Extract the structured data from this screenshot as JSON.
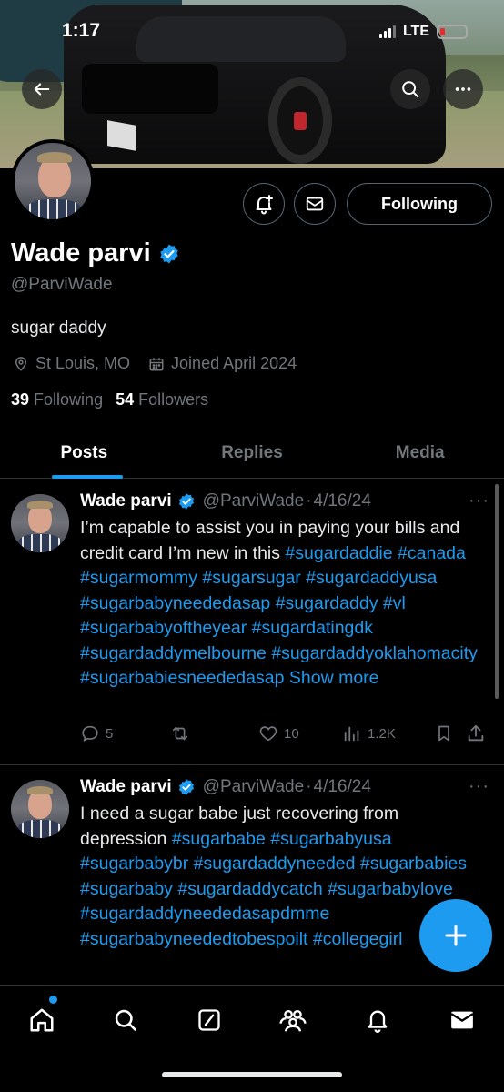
{
  "status_bar": {
    "time": "1:17",
    "network": "LTE"
  },
  "profile": {
    "name": "Wade parvi",
    "handle": "@ParviWade",
    "bio": "sugar daddy",
    "location": "St Louis, MO",
    "joined": "Joined April 2024",
    "following_count": "39",
    "following_label": "Following",
    "followers_count": "54",
    "followers_label": "Followers",
    "follow_button": "Following"
  },
  "tabs": [
    {
      "label": "Posts",
      "active": true
    },
    {
      "label": "Replies",
      "active": false
    },
    {
      "label": "Media",
      "active": false
    }
  ],
  "posts": [
    {
      "name": "Wade parvi",
      "handle": "@ParviWade",
      "sep": "·",
      "date": "4/16/24",
      "text": "I’m capable to assist you in paying your bills and credit card I’m new in this",
      "hashtags": [
        "#sugardaddie",
        "#canada",
        "#sugarmommy",
        "#sugarsugar",
        "#sugardaddyusa",
        "#sugarbabyneededasap",
        "#sugardaddy",
        "#vl",
        "#sugarbabyoftheyear",
        "#sugardatingdk",
        "#sugardaddymelbourne",
        "#sugardaddyoklahomacity",
        "#sugarbabiesneededasap"
      ],
      "show_more": "Show more",
      "replies": "5",
      "reposts": "",
      "likes": "10",
      "views": "1.2K"
    },
    {
      "name": "Wade parvi",
      "handle": "@ParviWade",
      "sep": "·",
      "date": "4/16/24",
      "text": "I need a sugar babe just recovering from depression",
      "hashtags": [
        "#sugarbabe",
        "#sugarbabyusa",
        "#sugarbabybr",
        "#sugardaddyneeded",
        "#sugarbabies",
        "#sugarbaby",
        "#sugardaddycatch",
        "#sugarbabylove",
        "#sugardaddyneededasapdmme",
        "#sugarbabyneededtobespoilt",
        "#collegegirl"
      ]
    }
  ],
  "colors": {
    "accent": "#1d9bf0",
    "background": "#000000",
    "muted": "#71767b",
    "battery_low": "#e0302f"
  },
  "icons": {
    "back": "arrow-left-icon",
    "search": "search-icon",
    "more": "more-horizontal-icon",
    "notify": "bell-plus-icon",
    "message": "envelope-icon",
    "location": "location-pin-icon",
    "calendar": "calendar-icon",
    "verified": "verified-badge-icon",
    "nav": [
      "home-icon",
      "search-icon",
      "grok-icon",
      "communities-icon",
      "notifications-icon",
      "messages-icon"
    ],
    "compose": "plus-icon"
  }
}
